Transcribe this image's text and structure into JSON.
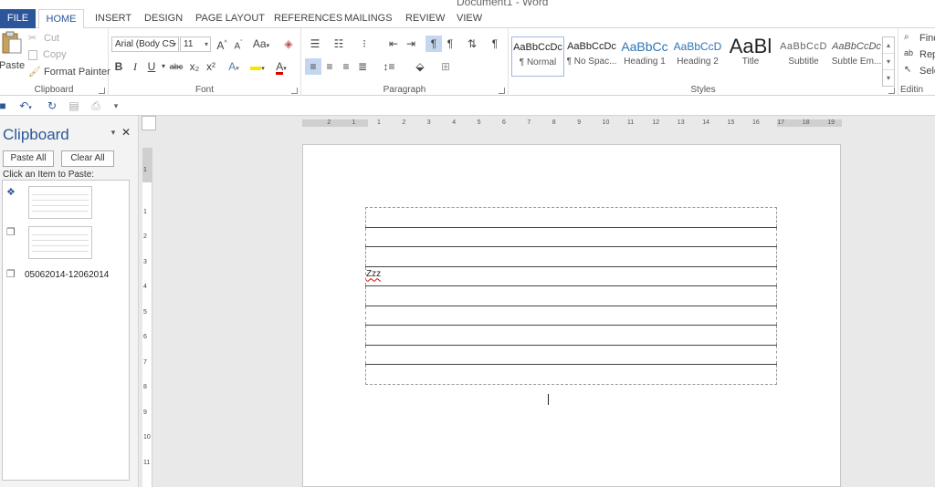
{
  "window": {
    "title": "Document1 - Word"
  },
  "tabs": [
    {
      "label": "FILE"
    },
    {
      "label": "HOME"
    },
    {
      "label": "INSERT"
    },
    {
      "label": "DESIGN"
    },
    {
      "label": "PAGE LAYOUT"
    },
    {
      "label": "REFERENCES"
    },
    {
      "label": "MAILINGS"
    },
    {
      "label": "REVIEW"
    },
    {
      "label": "VIEW"
    }
  ],
  "ribbon": {
    "clipboard": {
      "label": "Clipboard",
      "paste": "Paste",
      "cut": "Cut",
      "copy": "Copy",
      "format_painter": "Format Painter"
    },
    "font": {
      "label": "Font",
      "font_name": "Arial (Body CS",
      "font_size": "11",
      "change_case": "Aa",
      "bold": "B",
      "italic": "I",
      "underline": "U",
      "strike": "abc",
      "subscript": "x₂",
      "superscript": "x²",
      "grow": "A",
      "shrink": "A",
      "text_effects": "A",
      "font_color": "A",
      "highlight_color": "#f5e600",
      "font_color_value": "#e00000"
    },
    "paragraph": {
      "label": "Paragraph",
      "pilcrow": "¶"
    },
    "styles": {
      "label": "Styles",
      "items": [
        {
          "sample": "AaBbCcDc",
          "name": "¶ Normal"
        },
        {
          "sample": "AaBbCcDc",
          "name": "¶ No Spac..."
        },
        {
          "sample": "AaBbCc",
          "name": "Heading 1"
        },
        {
          "sample": "AaBbCcD",
          "name": "Heading 2"
        },
        {
          "sample": "AaBl",
          "name": "Title"
        },
        {
          "sample": "AaBbCcD",
          "name": "Subtitle"
        },
        {
          "sample": "AaBbCcDc",
          "name": "Subtle Em..."
        }
      ]
    },
    "editing": {
      "label": "Editin",
      "find": "Find",
      "replace": "Rep",
      "select": "Sele"
    }
  },
  "clipboard_pane": {
    "title": "Clipboard",
    "paste_all": "Paste All",
    "clear_all": "Clear All",
    "hint": "Click an Item to Paste:",
    "items": [
      {
        "type": "image"
      },
      {
        "type": "image"
      },
      {
        "type": "text",
        "text": "05062014-12062014"
      }
    ]
  },
  "ruler": {
    "h_ticks": [
      "2",
      "1",
      "1",
      "2",
      "3",
      "4",
      "5",
      "6",
      "7",
      "8",
      "9",
      "10",
      "11",
      "12",
      "13",
      "14",
      "15",
      "16",
      "17",
      "18",
      "19"
    ],
    "v_ticks": [
      "1",
      "1",
      "2",
      "3",
      "4",
      "5",
      "6",
      "7",
      "8",
      "9",
      "10",
      "11"
    ]
  },
  "document": {
    "rows": 9,
    "cell_text": "Zzz",
    "cell_text_row": 3
  },
  "colors": {
    "accent": "#2b579a",
    "file_tab": "#2b579a"
  }
}
